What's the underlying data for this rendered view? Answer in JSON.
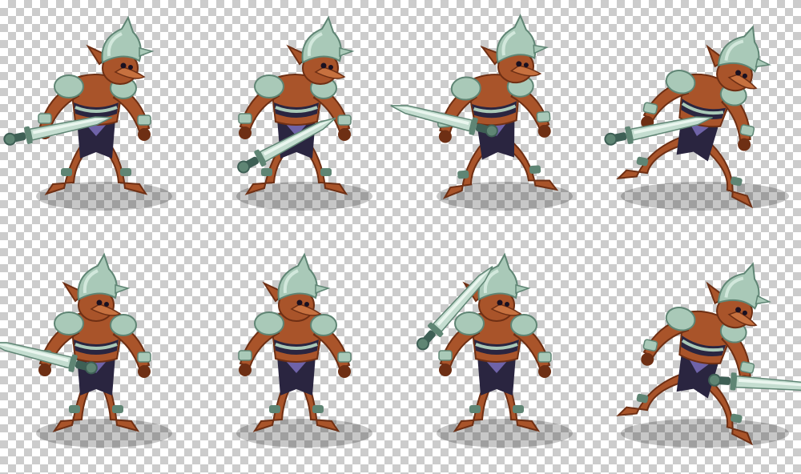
{
  "colors": {
    "skin": "#a9542a",
    "skin_dark": "#6e2f14",
    "skin_light": "#c7713f",
    "armor": "#a9c9b8",
    "armor_light": "#d2e8dc",
    "armor_dark": "#5f8574",
    "cloth": "#2a2540",
    "cloth_accent": "#6f63a8",
    "blade": "#c4ddd0",
    "blade_edge": "#eaf6ef",
    "hilt": "#3e5f55",
    "shadow": "#000000",
    "eye": "#1a1020",
    "wrap": "#5b4f8f"
  },
  "sprites": [
    {
      "name": "sprite-idle-1",
      "cell": [
        0,
        0
      ],
      "pose": "crouch",
      "sword": "low-right"
    },
    {
      "name": "sprite-idle-2",
      "cell": [
        1,
        0
      ],
      "pose": "crouch",
      "sword": "forward"
    },
    {
      "name": "sprite-idle-3",
      "cell": [
        2,
        0
      ],
      "pose": "wide",
      "sword": "out-left"
    },
    {
      "name": "sprite-run",
      "cell": [
        3,
        0
      ],
      "pose": "lunge",
      "sword": "low-right"
    },
    {
      "name": "sprite-front-1",
      "cell": [
        0,
        1
      ],
      "pose": "front",
      "sword": "out-left"
    },
    {
      "name": "sprite-front-2",
      "cell": [
        1,
        1
      ],
      "pose": "front-raise",
      "sword": "none"
    },
    {
      "name": "sprite-attack-raise",
      "cell": [
        2,
        1
      ],
      "pose": "front",
      "sword": "overhead"
    },
    {
      "name": "sprite-empty",
      "cell": [
        3,
        1
      ],
      "pose": "none",
      "sword": "none"
    },
    {
      "name": "sprite-lunge-attack",
      "cell": [
        3,
        1
      ],
      "pose": "lunge",
      "sword": "thrust-right"
    }
  ]
}
